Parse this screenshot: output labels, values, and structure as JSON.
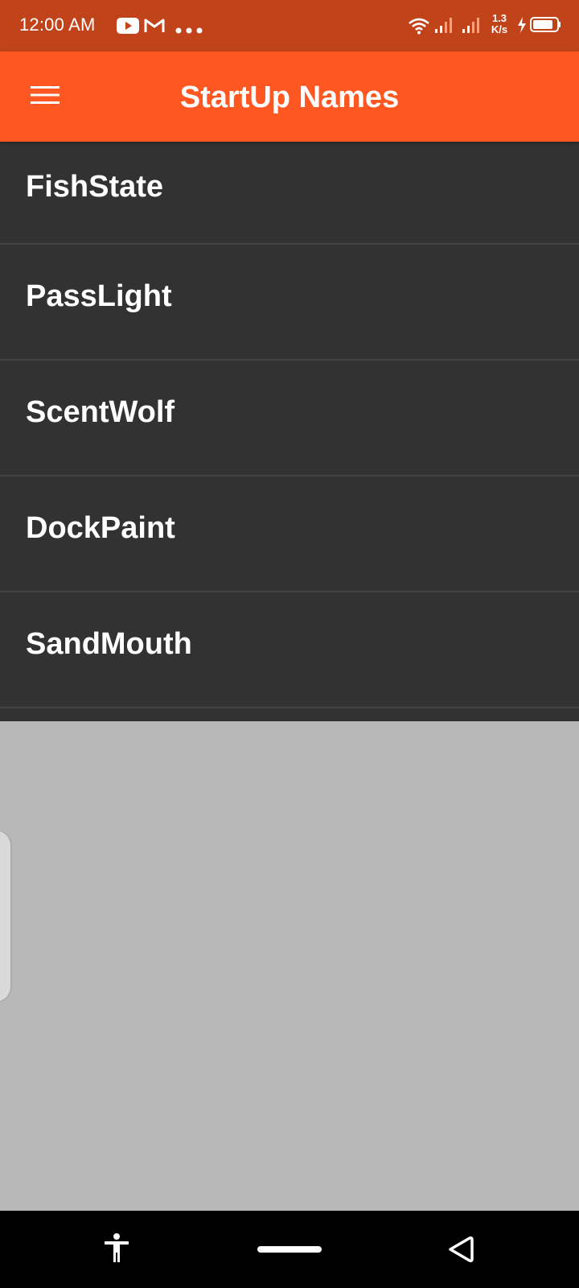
{
  "status_bar": {
    "time": "12:00 AM",
    "speed_top": "1.3",
    "speed_bottom": "K/s",
    "icons": [
      "youtube-icon",
      "gmail-icon",
      "more-dots-icon",
      "wifi-icon",
      "signal-icon",
      "signal-icon",
      "battery-charging-icon"
    ]
  },
  "app_bar": {
    "title": "StartUp Names",
    "menu_icon": "hamburger-menu-icon",
    "color": "#ff5722"
  },
  "names": [
    {
      "label": "FishState"
    },
    {
      "label": "PassLight"
    },
    {
      "label": "ScentWolf"
    },
    {
      "label": "DockPaint"
    },
    {
      "label": "SandMouth"
    }
  ],
  "nav_bar": {
    "icons": [
      "accessibility-icon",
      "home-pill-icon",
      "back-triangle-icon"
    ]
  },
  "colors": {
    "status_bar": "#c1431a",
    "accent": "#ff5722",
    "list_background": "#323232",
    "page_background": "#b8b8b8"
  }
}
